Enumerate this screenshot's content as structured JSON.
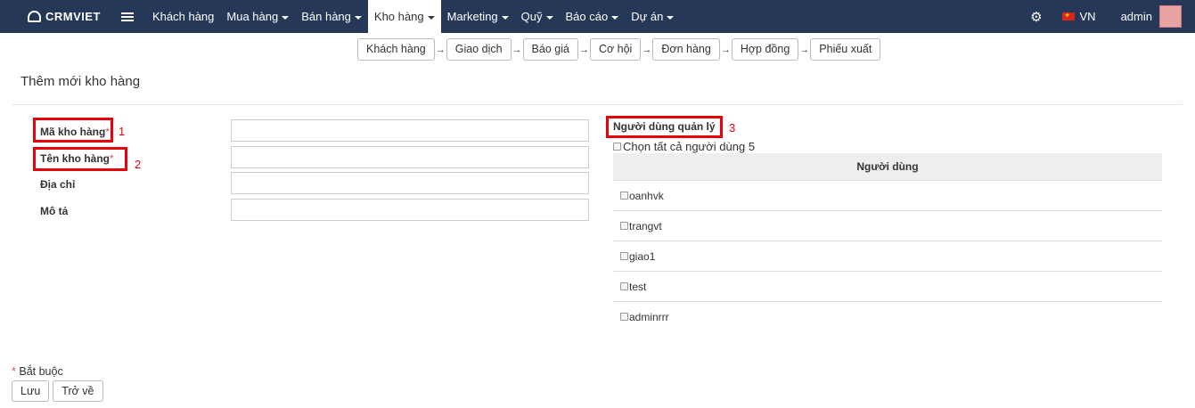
{
  "brand": {
    "name": "CRMVIET"
  },
  "nav": {
    "items": [
      {
        "label": "Khách hàng",
        "dropdown": false
      },
      {
        "label": "Mua hàng",
        "dropdown": true
      },
      {
        "label": "Bán hàng",
        "dropdown": true
      },
      {
        "label": "Kho hàng",
        "dropdown": true,
        "active": true
      },
      {
        "label": "Marketing",
        "dropdown": true
      },
      {
        "label": "Quỹ",
        "dropdown": true
      },
      {
        "label": "Báo cáo",
        "dropdown": true
      },
      {
        "label": "Dự án",
        "dropdown": true
      }
    ],
    "language": "VN",
    "user": "admin"
  },
  "workflow": [
    "Khách hàng",
    "Giao dịch",
    "Báo giá",
    "Cơ hội",
    "Đơn hàng",
    "Hợp đồng",
    "Phiếu xuất"
  ],
  "page": {
    "title": "Thêm mới kho hàng"
  },
  "form": {
    "code_label": "Mã kho hàng",
    "name_label": "Tên kho hàng",
    "address_label": "Địa chỉ",
    "desc_label": "Mô tả",
    "required_mark": "*",
    "code_value": "",
    "name_value": "",
    "address_value": "",
    "desc_value": ""
  },
  "annotations": {
    "n1": "1",
    "n2": "2",
    "n3": "3"
  },
  "managers": {
    "label": "Người dùng quản lý",
    "select_all": "Chọn tất cả người dùng 5",
    "column": "Người dùng",
    "users": [
      "oanhvk",
      "trangvt",
      "giao1",
      "test",
      "adminrrr"
    ]
  },
  "footer": {
    "required_note": "Bắt buộc",
    "save": "Lưu",
    "back": "Trở về"
  },
  "colors": {
    "nav_bg": "#253858",
    "highlight": "#e8000b"
  }
}
